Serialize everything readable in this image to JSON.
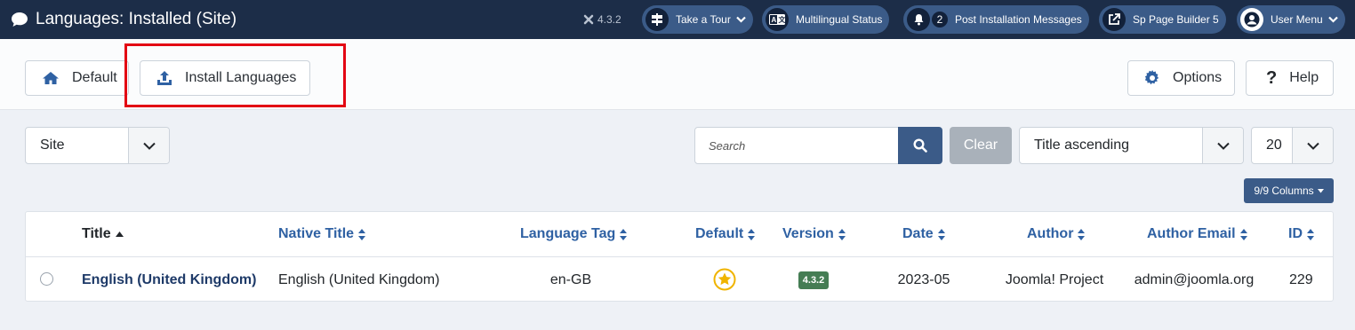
{
  "header": {
    "title": "Languages: Installed (Site)",
    "version": "4.3.2",
    "buttons": {
      "tour": "Take a Tour",
      "multilingual": "Multilingual Status",
      "post_install_count": "2",
      "post_install": "Post Installation Messages",
      "sp_builder": "Sp Page Builder 5",
      "user_menu": "User Menu"
    }
  },
  "toolbar": {
    "default_label": "Default",
    "install_label": "Install Languages",
    "options_label": "Options",
    "help_label": "Help"
  },
  "filters": {
    "client_value": "Site",
    "search_placeholder": "Search",
    "clear_label": "Clear",
    "ordering_value": "Title ascending",
    "limit_value": "20",
    "columns_label": "9/9 Columns"
  },
  "table": {
    "headers": {
      "title": "Title",
      "native_title": "Native Title",
      "language_tag": "Language Tag",
      "default": "Default",
      "version": "Version",
      "date": "Date",
      "author": "Author",
      "author_email": "Author Email",
      "id": "ID"
    },
    "rows": [
      {
        "title": "English (United Kingdom)",
        "native_title": "English (United Kingdom)",
        "language_tag": "en-GB",
        "version": "4.3.2",
        "date": "2023-05",
        "author": "Joomla! Project",
        "author_email": "admin@joomla.org",
        "id": "229"
      }
    ]
  },
  "colors": {
    "header_bg": "#1c2d48",
    "accent": "#3b5b88",
    "link": "#2f61a3",
    "highlight_box": "#e30613",
    "star": "#f0b400",
    "version_badge": "#457d54"
  }
}
